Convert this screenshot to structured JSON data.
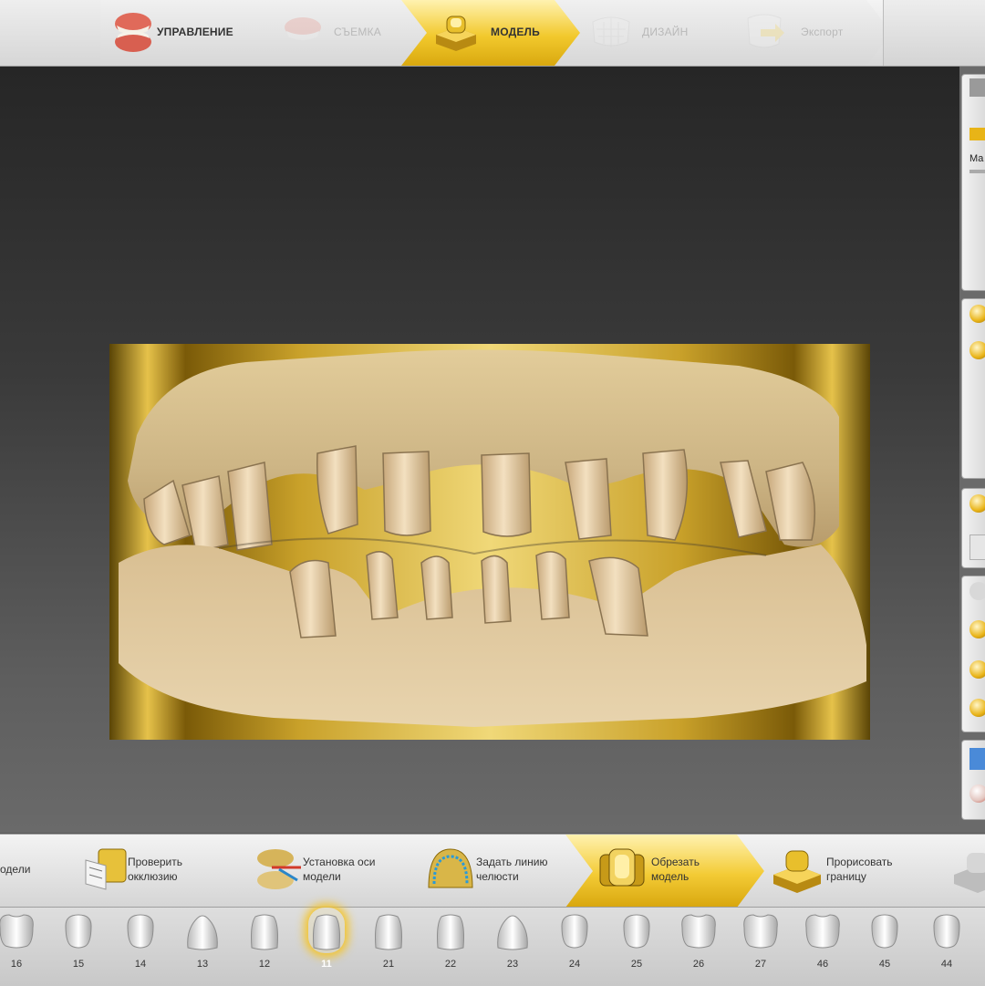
{
  "workflow_steps": [
    {
      "label": "УПРАВЛЕНИЕ",
      "state": "normal",
      "icon": "denture-icon"
    },
    {
      "label": "СЪЕМКА",
      "state": "disabled",
      "icon": "scan-jaw-icon"
    },
    {
      "label": "МОДЕЛЬ",
      "state": "active",
      "icon": "model-die-icon"
    },
    {
      "label": "ДИЗАЙН",
      "state": "disabled",
      "icon": "design-crown-icon"
    },
    {
      "label": "Экспорт",
      "state": "disabled",
      "icon": "export-icon"
    }
  ],
  "tools": [
    {
      "label": "одели",
      "icon": "model-icon"
    },
    {
      "label": "Проверить\nокклюзию",
      "icon": "check-occlusion-icon"
    },
    {
      "label": "Установка оси\nмодели",
      "icon": "model-axis-icon"
    },
    {
      "label": "Задать линию\nчелюсти",
      "icon": "jaw-line-icon"
    },
    {
      "label": "Обрезать\nмодель",
      "icon": "trim-model-icon",
      "active": true
    },
    {
      "label": "Прорисовать\nграницу",
      "icon": "draw-margin-icon"
    }
  ],
  "right_panel": {
    "truncated_label": "Ма"
  },
  "teeth": [
    {
      "number": "16",
      "type": "molar"
    },
    {
      "number": "15",
      "type": "premolar"
    },
    {
      "number": "14",
      "type": "premolar"
    },
    {
      "number": "13",
      "type": "canine"
    },
    {
      "number": "12",
      "type": "incisor"
    },
    {
      "number": "11",
      "type": "incisor",
      "selected": true
    },
    {
      "number": "21",
      "type": "incisor"
    },
    {
      "number": "22",
      "type": "incisor"
    },
    {
      "number": "23",
      "type": "canine"
    },
    {
      "number": "24",
      "type": "premolar"
    },
    {
      "number": "25",
      "type": "premolar"
    },
    {
      "number": "26",
      "type": "molar"
    },
    {
      "number": "27",
      "type": "molar"
    },
    {
      "number": "46",
      "type": "molar"
    },
    {
      "number": "45",
      "type": "premolar"
    },
    {
      "number": "44",
      "type": "premolar"
    }
  ],
  "colors": {
    "accent": "#f2c92d",
    "viewport_top": "#262626",
    "model_base": "#d9c294",
    "model_gold": "#d4a823"
  }
}
